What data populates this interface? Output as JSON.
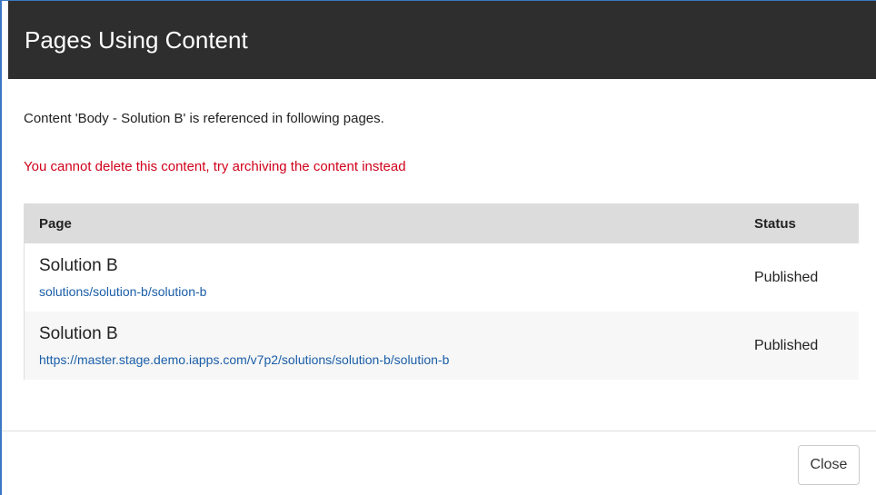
{
  "modal": {
    "title": "Pages Using Content",
    "message": "Content 'Body - Solution B' is referenced in following pages.",
    "warning": "You cannot delete this content, try archiving the content instead",
    "colors": {
      "header_bg": "#2e2e2e",
      "warning_text": "#d0021b",
      "link_text": "#1a5ea8",
      "table_header_bg": "#dcdcdc"
    }
  },
  "table": {
    "headers": {
      "page": "Page",
      "status": "Status"
    },
    "rows": [
      {
        "name": "Solution B",
        "url": "solutions/solution-b/solution-b",
        "status": "Published"
      },
      {
        "name": "Solution B",
        "url": "https://master.stage.demo.iapps.com/v7p2/solutions/solution-b/solution-b",
        "status": "Published"
      }
    ]
  },
  "footer": {
    "close_label": "Close"
  }
}
